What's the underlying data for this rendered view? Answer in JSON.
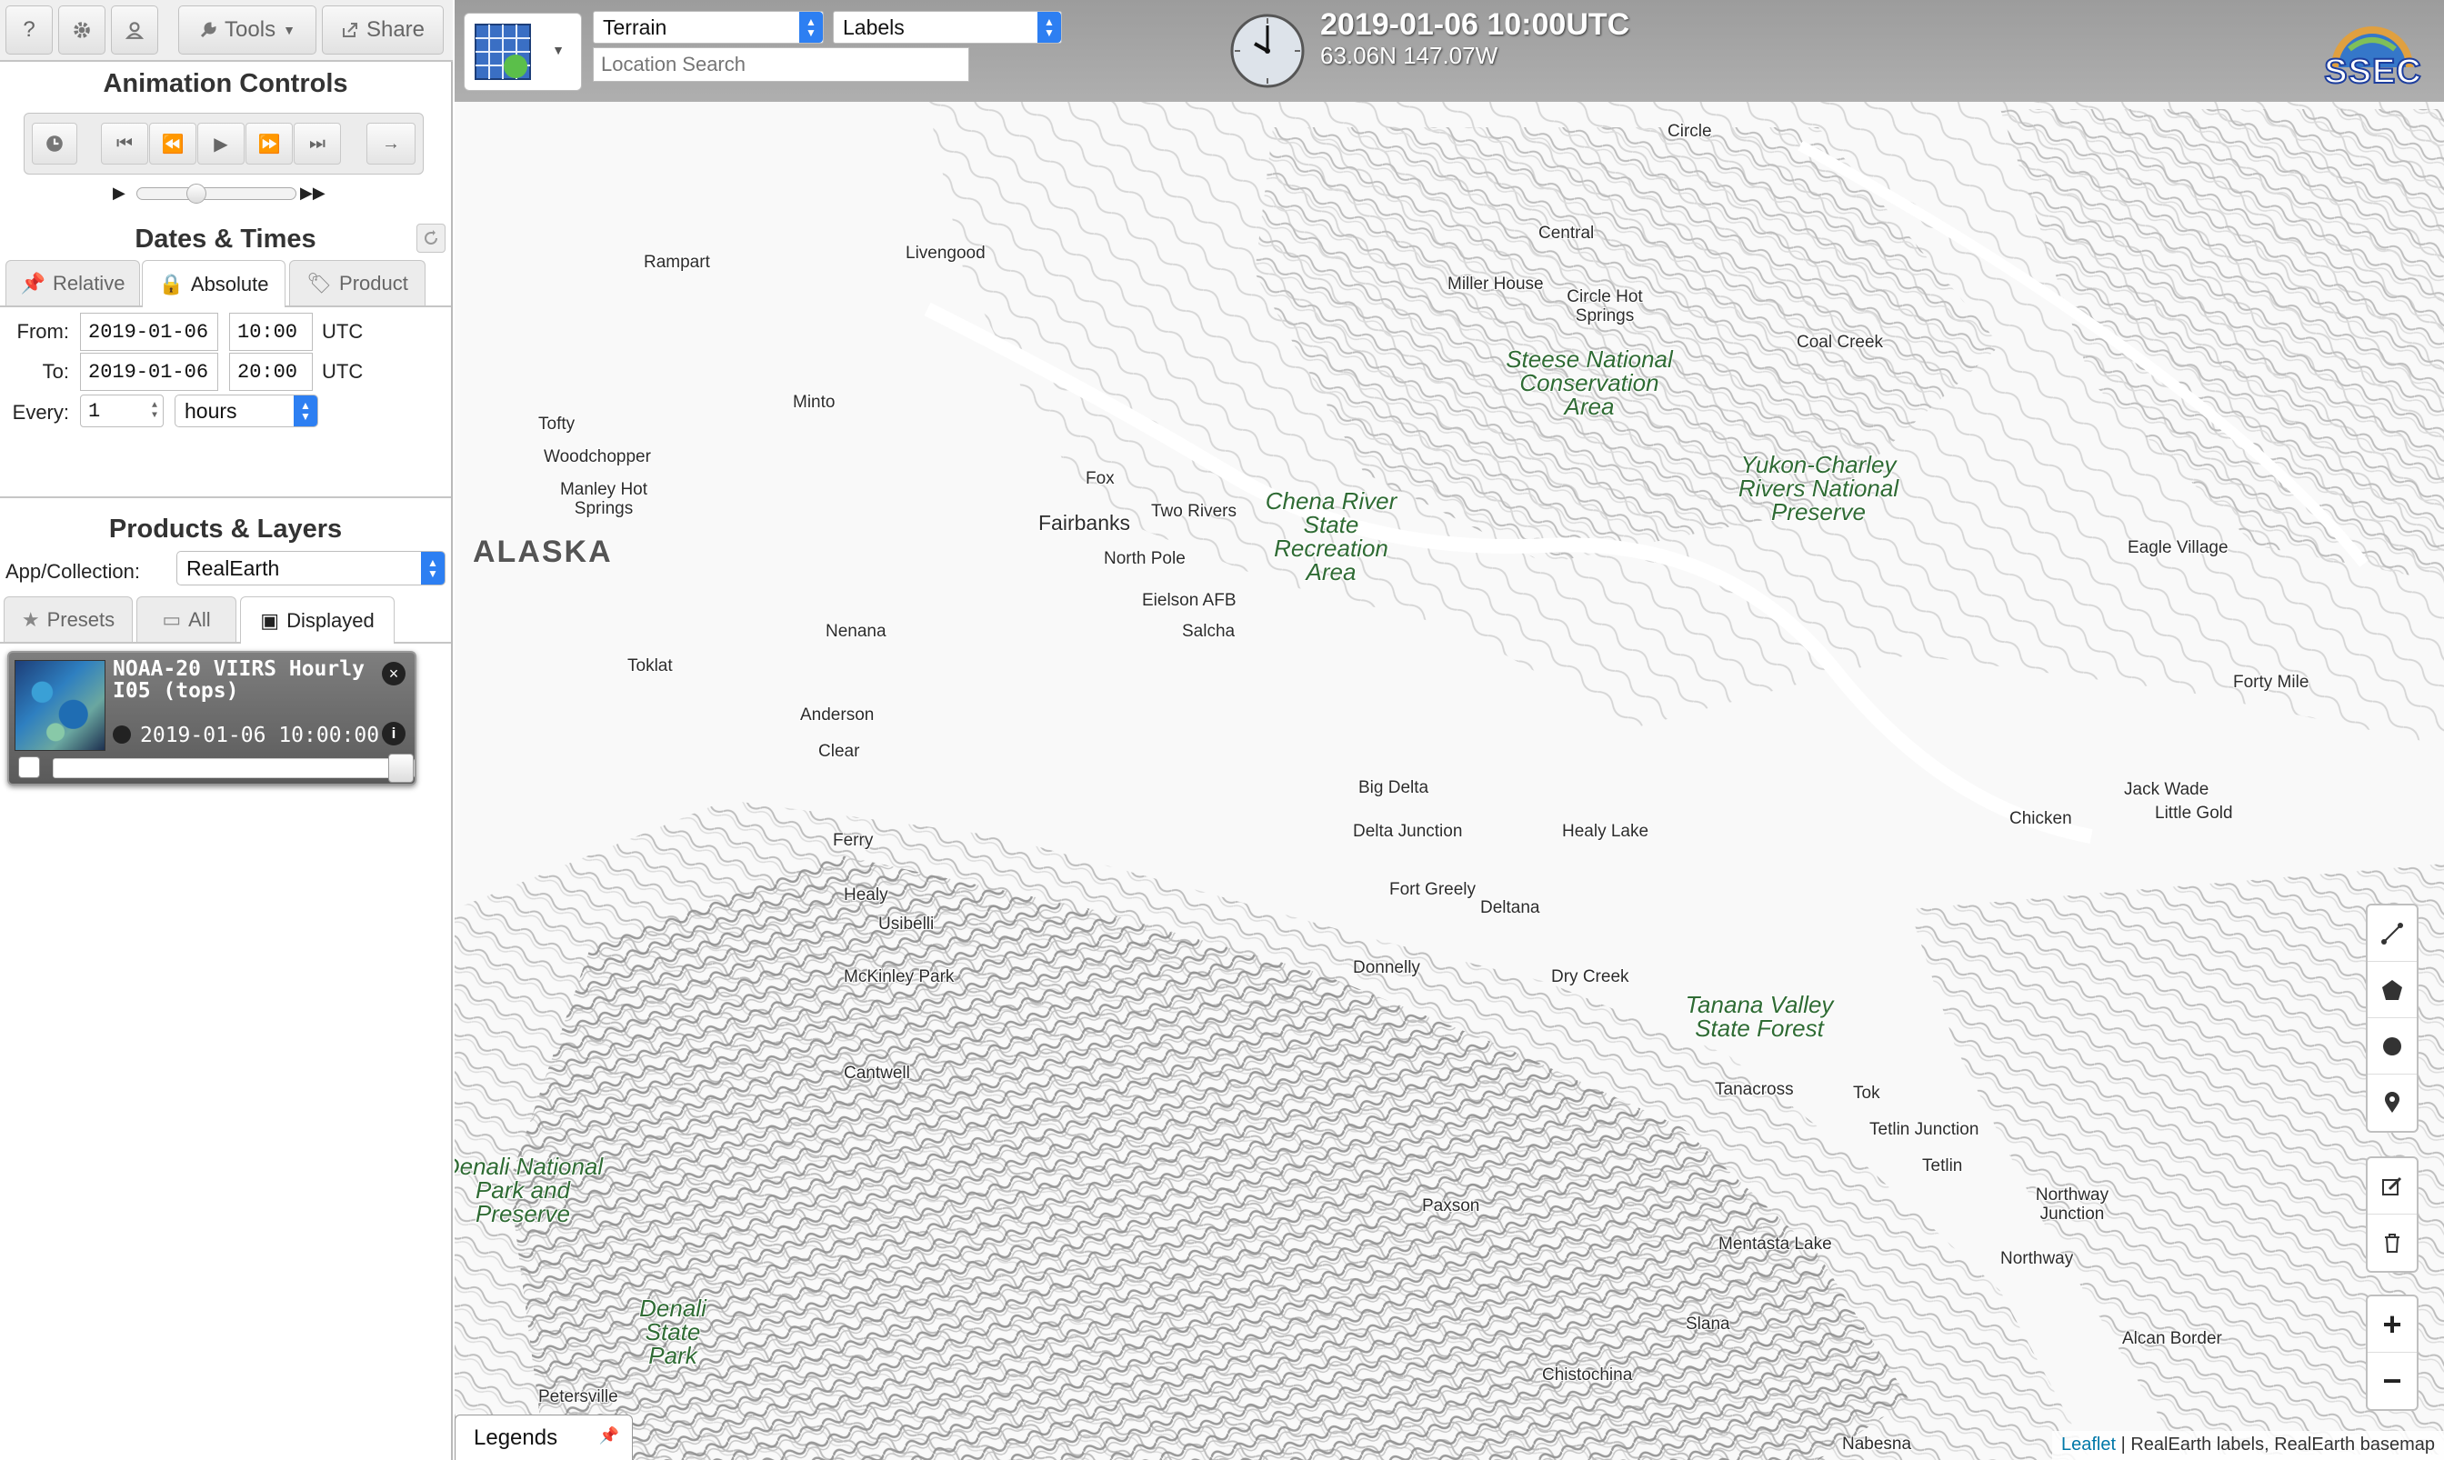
{
  "toolbar": {
    "help": "?",
    "tools_label": "Tools",
    "share_label": "Share"
  },
  "animation": {
    "title": "Animation Controls",
    "speed_position": 0.35
  },
  "dates": {
    "title": "Dates & Times",
    "tabs": [
      "Relative",
      "Absolute",
      "Product"
    ],
    "active_tab": "Absolute",
    "from_label": "From:",
    "from_date": "2019-01-06",
    "from_time": "10:00",
    "to_label": "To:",
    "to_date": "2019-01-06",
    "to_time": "20:00",
    "tz": "UTC",
    "every_label": "Every:",
    "every_value": "1",
    "every_unit": "hours"
  },
  "products": {
    "title": "Products & Layers",
    "app_label": "App/Collection:",
    "app_value": "RealEarth",
    "tabs": [
      "Presets",
      "All",
      "Displayed"
    ],
    "active_tab": "Displayed",
    "layer": {
      "title": "NOAA-20 VIIRS Hourly I05 (tops)",
      "time": "2019-01-06 10:00:00",
      "opacity": 1.0
    }
  },
  "map_header": {
    "basemap": "Terrain",
    "overlay": "Labels",
    "search_placeholder": "Location Search",
    "datetime": "2019-01-06 10:00UTC",
    "coords": "63.06N 147.07W",
    "logo_text": "SSEC"
  },
  "legends_label": "Legends",
  "attribution": {
    "link": "Leaflet",
    "text": "| RealEarth labels, RealEarth basemap"
  },
  "labels": {
    "region": "ALASKA",
    "places": [
      "Circle",
      "Central",
      "Miller House",
      "Circle Hot Springs",
      "Coal Creek",
      "Rampart",
      "Livengood",
      "Minto",
      "Tofty",
      "Woodchopper",
      "Manley Hot Springs",
      "Fox",
      "Fairbanks",
      "Two Rivers",
      "North Pole",
      "Eielson AFB",
      "Salcha",
      "Nenana",
      "Eagle Village",
      "Forty Mile",
      "Toklat",
      "Anderson",
      "Clear",
      "Big Delta",
      "Delta Junction",
      "Healy Lake",
      "Jack Wade",
      "Little Gold",
      "Chicken",
      "Ferry",
      "Healy",
      "Usibelli",
      "Fort Greely",
      "Deltana",
      "McKinley Park",
      "Donnelly",
      "Dry Creek",
      "Cantwell",
      "Tanacross",
      "Tok",
      "Tetlin Junction",
      "Tetlin",
      "Paxson",
      "Northway Junction",
      "Mentasta Lake",
      "Northway",
      "Slana",
      "Alcan Border",
      "Chistochina",
      "Petersville",
      "Nabesna"
    ],
    "parks": [
      "Steese National Conservation Area",
      "Yukon-Charley Rivers National Preserve",
      "Chena River State Recreation Area",
      "Tanana Valley State Forest",
      "Denali National Park and Preserve",
      "Denali State Park"
    ]
  },
  "colors": {
    "accent": "#2d7ff2",
    "park_text": "#2f6b34",
    "header_bg": "#8c8c8c"
  }
}
